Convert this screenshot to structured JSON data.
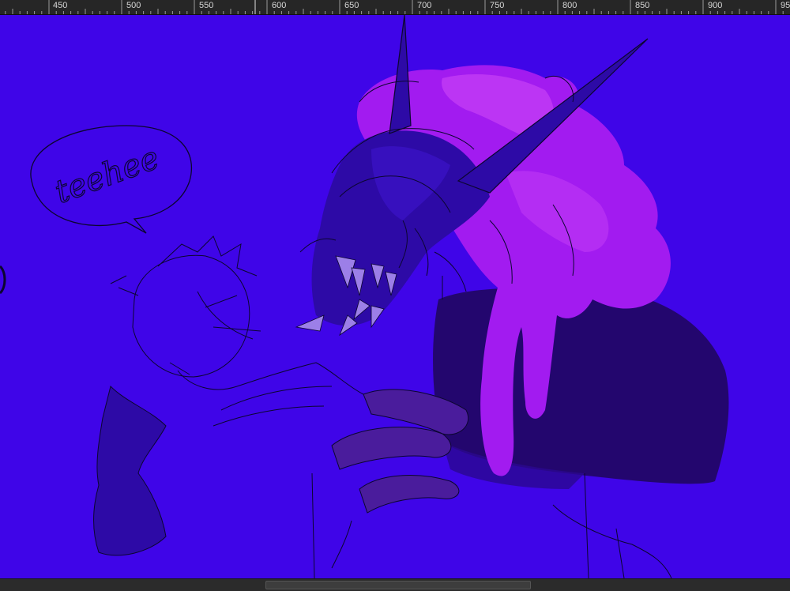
{
  "ruler": {
    "labels": [
      "450",
      "500",
      "550",
      "600",
      "650",
      "700",
      "750",
      "800",
      "850",
      "900",
      "95"
    ],
    "cursor_mark": "cursor"
  },
  "canvas": {
    "background_color": "#3f05e8",
    "speech_bubble_text": "teehee",
    "colors": {
      "mane": "#a21bf0",
      "mane_light": "#c33cf5",
      "body_dark": "#23066e",
      "shadow": "#2d0aa6",
      "claws": "#4a1c9c",
      "teeth": "#9c7fe8",
      "line": "#0c0630"
    }
  },
  "scrollbar": {
    "position": 0.336,
    "visible_fraction": 0.336
  }
}
